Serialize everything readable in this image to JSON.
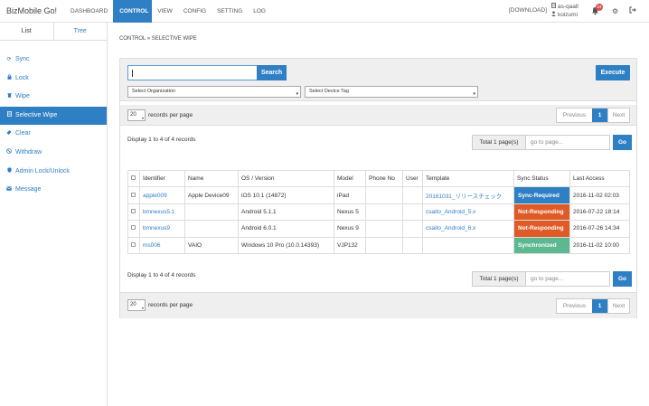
{
  "app": {
    "title": "BizMobile Go!"
  },
  "nav": {
    "dashboard": "DASHBOARD",
    "control": "CONTROL",
    "view": "VIEW",
    "config": "CONFIG",
    "setting": "SETTING",
    "log": "LOG"
  },
  "topright": {
    "download": "[DOWNLOAD]",
    "org": "as-qaall",
    "user": "koizumi",
    "badge_count": "24"
  },
  "sidebar": {
    "tabs": [
      "List",
      "Tree"
    ],
    "items": [
      {
        "label": "Sync",
        "icon": "sync-icon"
      },
      {
        "label": "Lock",
        "icon": "lock-icon"
      },
      {
        "label": "Wipe",
        "icon": "trash-icon"
      },
      {
        "label": "Selective Wipe",
        "icon": "document-icon"
      },
      {
        "label": "Clear",
        "icon": "eraser-icon"
      },
      {
        "label": "Withdraw",
        "icon": "ban-icon"
      },
      {
        "label": "Admin Lock/Unlock",
        "icon": "shield-icon"
      },
      {
        "label": "Message",
        "icon": "envelope-icon"
      }
    ]
  },
  "breadcrumb": "CONTROL » SELECTIVE WIPE",
  "filter": {
    "search_value": "",
    "search_label": "Search",
    "execute_label": "Execute",
    "org_select": "Select Organization",
    "tag_select": "Select Device Tag"
  },
  "pager": {
    "per_page_value": "20",
    "per_page_label": "records per page",
    "prev": "Previous",
    "current": "1",
    "next": "Next",
    "display_info": "Display 1 to 4 of 4 records",
    "total_pages": "Total 1 page(s)",
    "goto_placeholder": "go to page...",
    "go_label": "Go"
  },
  "table": {
    "headers": [
      "Identifier",
      "Name",
      "OS / Version",
      "Model",
      "Phone No",
      "User",
      "Template",
      "Sync Status",
      "Last Access"
    ],
    "rows": [
      {
        "identifier": "apple009",
        "name": "Apple Device09",
        "os": "iOS 10.1 (14872)",
        "model": "iPad",
        "phone": "",
        "user": "",
        "template": "20161031_リリースチェック",
        "status": "Sync-Required",
        "last_access": "2016-11-02 02:03"
      },
      {
        "identifier": "bmnexus5.1",
        "name": "",
        "os": "Android 5.1.1",
        "model": "Nexus 5",
        "phone": "",
        "user": "",
        "template": "csaito_Android_5.x",
        "status": "Not-Responding",
        "last_access": "2016-07-22 18:14"
      },
      {
        "identifier": "bmnexus9",
        "name": "",
        "os": "Android 6.0.1",
        "model": "Nexus 9",
        "phone": "",
        "user": "",
        "template": "csaito_Android_6.x",
        "status": "Not-Responding",
        "last_access": "2016-07-26 14:34"
      },
      {
        "identifier": "ms006",
        "name": "VAIO",
        "os": "Windows 10 Pro (10.0.14393)",
        "model": "VJP132",
        "phone": "",
        "user": "",
        "template": "",
        "status": "Synchronized",
        "last_access": "2016-11-02 10:00"
      }
    ]
  },
  "colors": {
    "primary": "#2f7fc4",
    "sync_required": "#2f7fc4",
    "not_responding": "#e05a26",
    "synchronized": "#5cb890"
  }
}
